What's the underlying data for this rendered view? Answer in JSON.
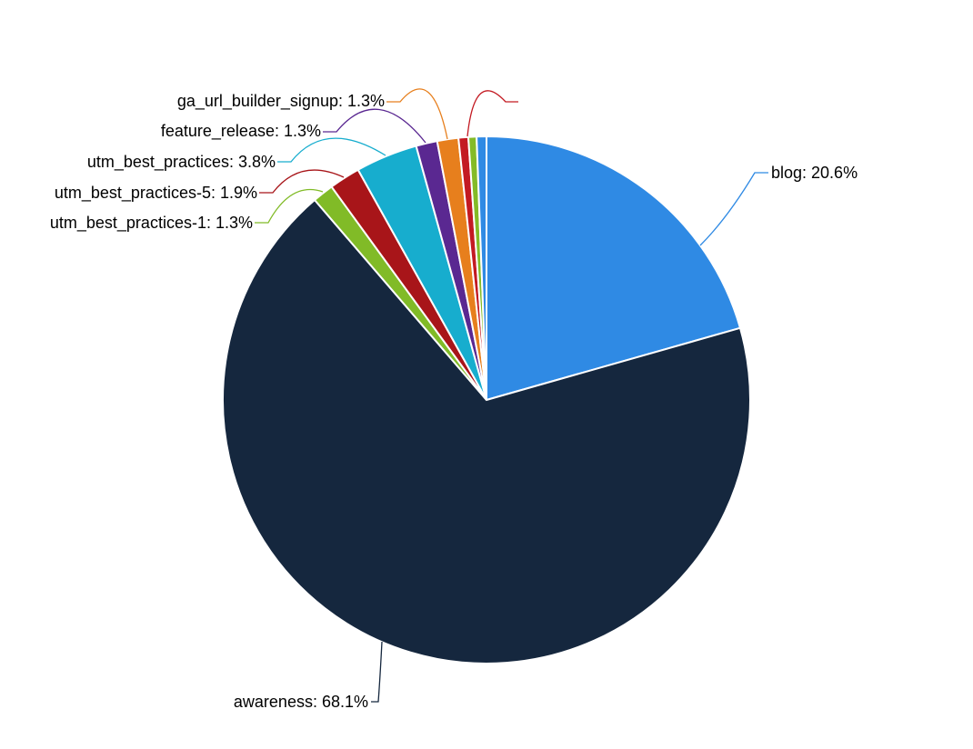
{
  "chart_data": {
    "type": "pie",
    "slices": [
      {
        "name": "blog",
        "percent": 20.6,
        "color": "#2f8ae4"
      },
      {
        "name": "awareness",
        "percent": 68.1,
        "color": "#15273e"
      },
      {
        "name": "utm_best_practices-1",
        "percent": 1.3,
        "color": "#81bb27"
      },
      {
        "name": "utm_best_practices-5",
        "percent": 1.9,
        "color": "#a81519"
      },
      {
        "name": "utm_best_practices",
        "percent": 3.8,
        "color": "#17adce"
      },
      {
        "name": "feature_release",
        "percent": 1.3,
        "color": "#5a2891"
      },
      {
        "name": "ga_url_builder_signup",
        "percent": 1.3,
        "color": "#e77f1d"
      },
      {
        "name": "_unlabeled_a",
        "percent": 0.6,
        "color": "#c31a22"
      },
      {
        "name": "_unlabeled_b",
        "percent": 0.5,
        "color": "#84bb27"
      },
      {
        "name": "_unlabeled_c",
        "percent": 0.6,
        "color": "#2f8ae4"
      }
    ]
  },
  "labels": {
    "blog": "blog: 20.6%",
    "awareness": "awareness: 68.1%",
    "utm_best_practices_1": "utm_best_practices-1: 1.3%",
    "utm_best_practices_5": "utm_best_practices-5: 1.9%",
    "utm_best_practices": "utm_best_practices: 3.8%",
    "feature_release": "feature_release: 1.3%",
    "ga_url_builder_signup": "ga_url_builder_signup: 1.3%"
  }
}
